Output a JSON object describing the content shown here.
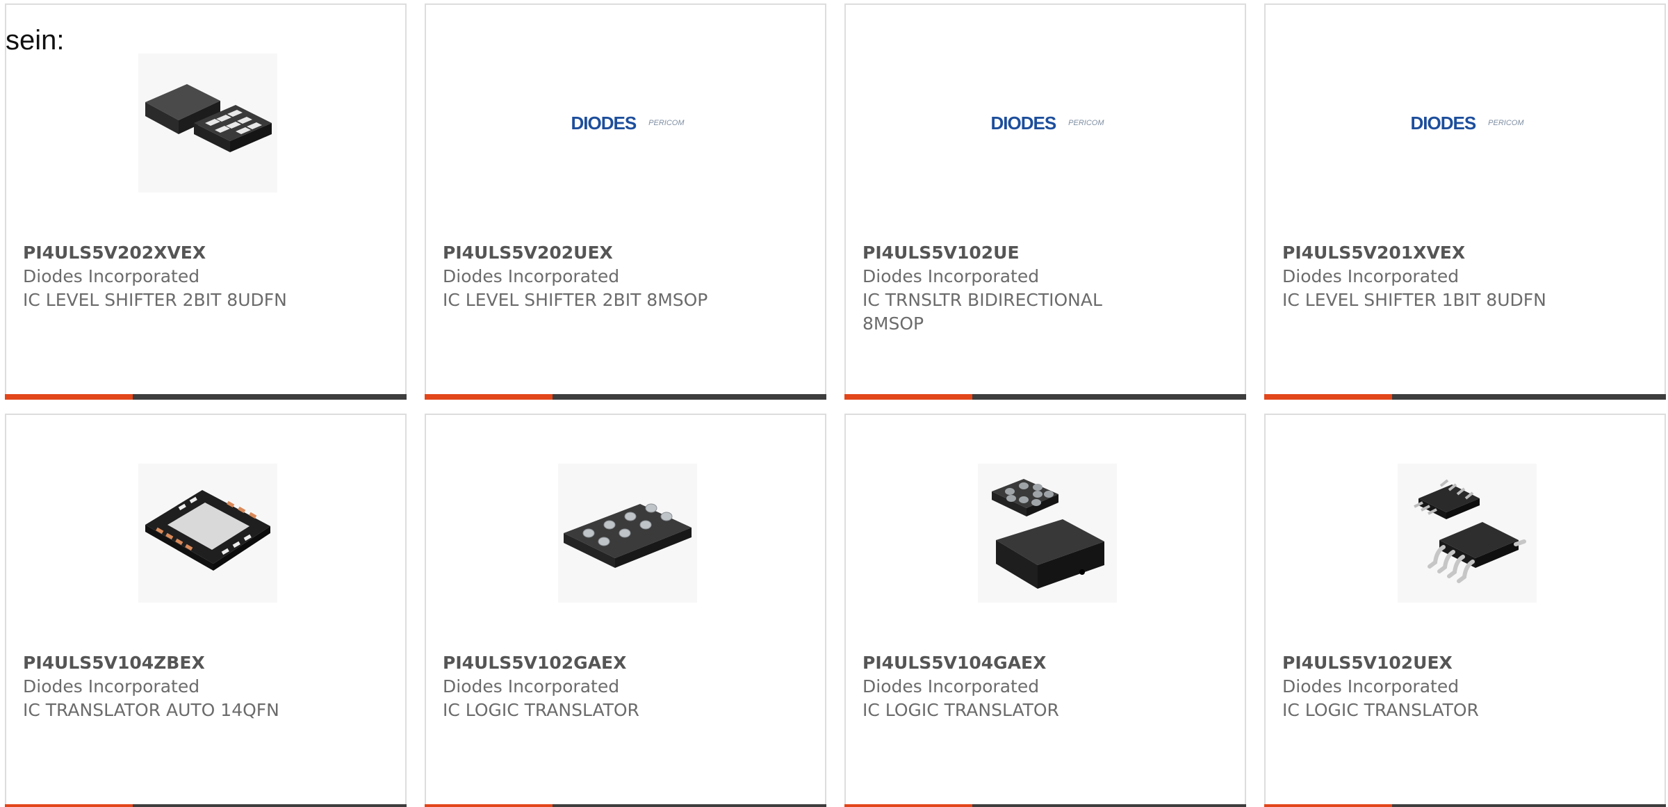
{
  "intro_text": "sein:",
  "colors": {
    "accent": "#e2461b",
    "bar": "#3e3e3e",
    "text": "#6b6b6b",
    "part_number": "#555555"
  },
  "logo": {
    "brand": "DIODES",
    "sub_brand": "PERICOM"
  },
  "products": [
    {
      "part_number": "PI4ULS5V202XVEX",
      "manufacturer": "Diodes Incorporated",
      "description": "IC LEVEL SHIFTER 2BIT 8UDFN",
      "image": "udfn-package-icon"
    },
    {
      "part_number": "PI4ULS5V202UEX",
      "manufacturer": "Diodes Incorporated",
      "description": "IC LEVEL SHIFTER 2BIT 8MSOP",
      "image": "diodes-pericom-logo"
    },
    {
      "part_number": "PI4ULS5V102UE",
      "manufacturer": "Diodes Incorporated",
      "description": "IC TRNSLTR BIDIRECTIONAL 8MSOP",
      "image": "diodes-pericom-logo"
    },
    {
      "part_number": "PI4ULS5V201XVEX",
      "manufacturer": "Diodes Incorporated",
      "description": "IC LEVEL SHIFTER 1BIT 8UDFN",
      "image": "diodes-pericom-logo"
    },
    {
      "part_number": "PI4ULS5V104ZBEX",
      "manufacturer": "Diodes Incorporated",
      "description": "IC TRANSLATOR AUTO 14QFN",
      "image": "qfn-package-icon"
    },
    {
      "part_number": "PI4ULS5V102GAEX",
      "manufacturer": "Diodes Incorporated",
      "description": "IC LOGIC TRANSLATOR",
      "image": "bga-package-icon"
    },
    {
      "part_number": "PI4ULS5V104GAEX",
      "manufacturer": "Diodes Incorporated",
      "description": "IC LOGIC TRANSLATOR",
      "image": "csp-package-icon"
    },
    {
      "part_number": "PI4ULS5V102UEX",
      "manufacturer": "Diodes Incorporated",
      "description": "IC LOGIC TRANSLATOR",
      "image": "msop-package-icon"
    }
  ]
}
